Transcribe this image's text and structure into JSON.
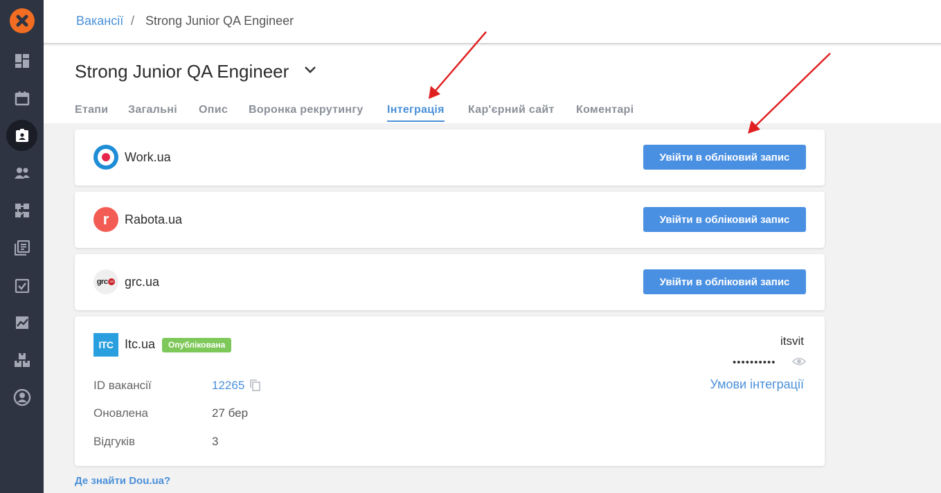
{
  "breadcrumb": {
    "parent": "Вакансії",
    "separator": "/",
    "current": "Strong Junior QA Engineer"
  },
  "page": {
    "title": "Strong Junior QA Engineer"
  },
  "tabs": [
    {
      "label": "Етапи",
      "active": false
    },
    {
      "label": "Загальні",
      "active": false
    },
    {
      "label": "Опис",
      "active": false
    },
    {
      "label": "Воронка рекрутингу",
      "active": false
    },
    {
      "label": "Інтеграція",
      "active": true
    },
    {
      "label": "Кар'єрний сайт",
      "active": false
    },
    {
      "label": "Коментарі",
      "active": false
    }
  ],
  "integrations": [
    {
      "name": "Work.ua",
      "button": "Увійти в обліковий запис",
      "logo": "work-ua-logo"
    },
    {
      "name": "Rabota.ua",
      "button": "Увійти в обліковий запис",
      "logo": "rabota-ua-logo",
      "logo_text": "r"
    },
    {
      "name": "grc.ua",
      "button": "Увійти в обліковий запис",
      "logo": "grc-ua-logo",
      "logo_text": "grc",
      "logo_badge": "ua"
    }
  ],
  "itc": {
    "name": "Itc.ua",
    "logo_text": "ITC",
    "status": "Опублікована",
    "login": "itsvit",
    "password_mask": "••••••••••",
    "terms_link": "Умови інтеграції",
    "rows": [
      {
        "label": "ID вакансії",
        "value": "12265"
      },
      {
        "label": "Оновлена",
        "value": "27 бер"
      },
      {
        "label": "Відгуків",
        "value": "3"
      }
    ]
  },
  "footer": {
    "link": "Де знайти Dou.ua?"
  },
  "colors": {
    "accent": "#4a90d9",
    "button": "#4a90e2",
    "sidebar": "#2f3443",
    "logo": "#f26d21",
    "published": "#7dc858",
    "arrow": "#e02020"
  },
  "sidebar_icons": [
    "dashboard-icon",
    "calendar-icon",
    "vacancies-icon",
    "candidates-icon",
    "workflow-icon",
    "library-icon",
    "tasks-icon",
    "analytics-icon",
    "integrations-icon",
    "profile-icon"
  ]
}
